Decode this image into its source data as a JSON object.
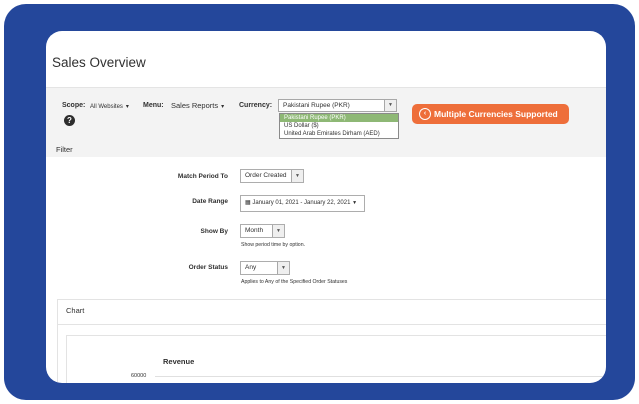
{
  "page": {
    "title": "Sales Overview"
  },
  "toolbar": {
    "scope_label": "Scope:",
    "scope_value": "All Websites",
    "menu_label": "Menu:",
    "menu_value": "Sales Reports",
    "currency_label": "Currency:",
    "currency_selected": "Pakistani Rupee (PKR)",
    "currency_options": [
      "Pakistani Rupee (PKR)",
      "US Dollar ($)",
      "United Arab Emirates Dirham (AED)"
    ],
    "badge_text": "Multiple Currencies Supported"
  },
  "filter": {
    "title": "Filter",
    "match_period_label": "Match Period To",
    "match_period_value": "Order Created",
    "date_range_label": "Date Range",
    "date_range_value": "January 01, 2021 - January 22, 2021",
    "show_by_label": "Show By",
    "show_by_value": "Month",
    "show_by_note": "Show period time by option.",
    "order_status_label": "Order Status",
    "order_status_value": "Any",
    "order_status_note": "Applies to Any of the Specified Order Statuses"
  },
  "chart": {
    "section_title": "Chart",
    "heading": "Revenue",
    "y_tick": "60000"
  },
  "colors": {
    "frame": "#24479b",
    "badge": "#ee6e3a",
    "selected_option": "#8eb875"
  }
}
